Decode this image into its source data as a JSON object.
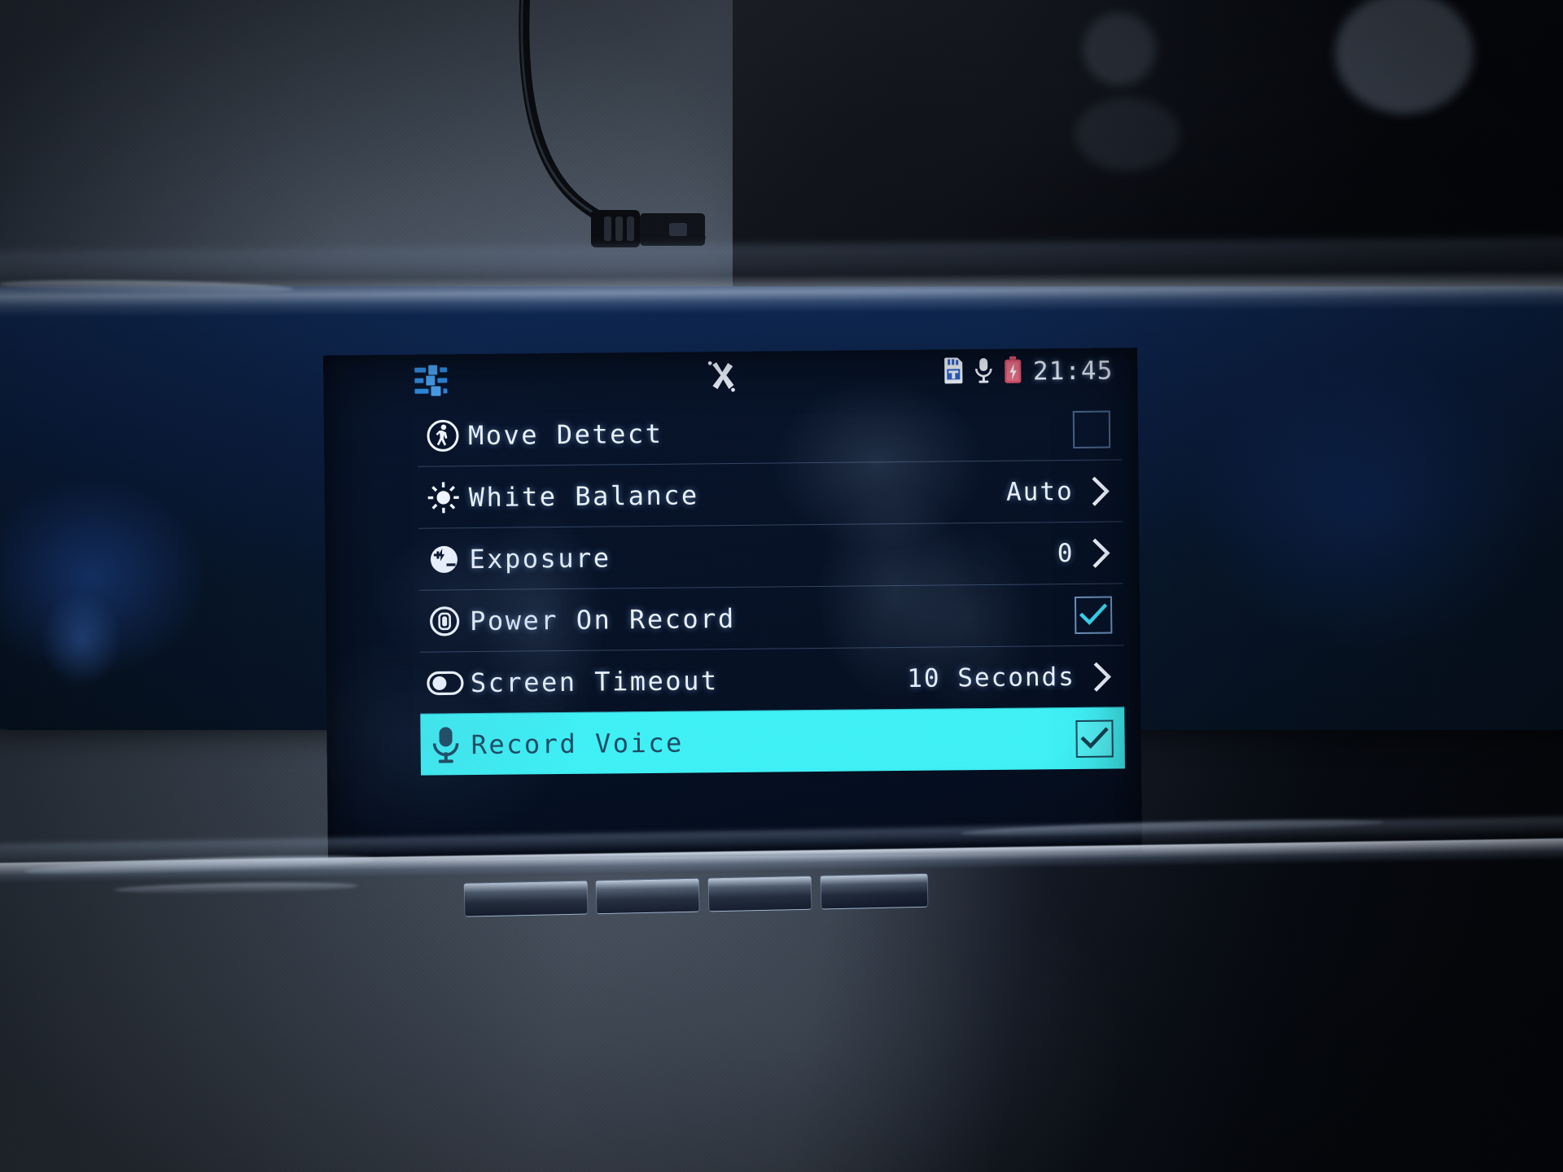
{
  "device": {
    "type": "dashcam-rearview-mirror",
    "screen_label": "Settings Menu"
  },
  "status_bar": {
    "settings_icon": "sliders-icon",
    "center_icon": "motion-cross-icon",
    "sd_card_icon": "sd-card-icon",
    "mic_icon": "microphone-icon",
    "battery_icon": "battery-charging-icon",
    "time": "21:45"
  },
  "menu": {
    "items": [
      {
        "icon": "pedestrian-icon",
        "label": "Move Detect",
        "control": "checkbox",
        "checked": false,
        "value": ""
      },
      {
        "icon": "sun-icon",
        "label": "White Balance",
        "control": "chevron",
        "checked": false,
        "value": "Auto"
      },
      {
        "icon": "exposure-icon",
        "label": "Exposure",
        "control": "chevron",
        "checked": false,
        "value": "0"
      },
      {
        "icon": "power-record-icon",
        "label": "Power On Record",
        "control": "checkbox",
        "checked": true,
        "value": ""
      },
      {
        "icon": "toggle-icon",
        "label": "Screen Timeout",
        "control": "chevron",
        "checked": false,
        "value": "10 Seconds"
      },
      {
        "icon": "microphone-icon",
        "label": "Record Voice",
        "control": "checkbox",
        "checked": true,
        "value": "",
        "selected": true
      }
    ]
  },
  "colors": {
    "highlight": "#3ef0f5",
    "screen_bg": "#061126",
    "text": "#e9f1ff",
    "accent_blue": "#2f8fe8",
    "battery_red": "#e0536f",
    "check_cyan": "#36d8f0"
  }
}
